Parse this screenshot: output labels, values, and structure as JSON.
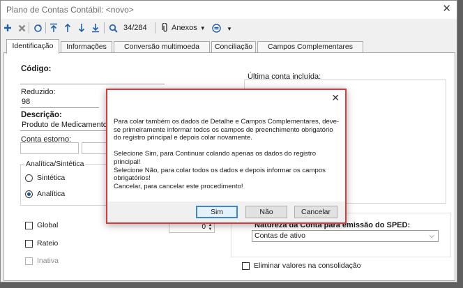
{
  "window": {
    "title": "Plano de Contas Contábil: <novo>",
    "close_glyph": "✕"
  },
  "toolbar": {
    "counter": "34/284",
    "anexos_label": "Anexos",
    "icons": [
      "plus-icon",
      "delete-icon",
      "refresh-icon",
      "first-record-icon",
      "previous-record-icon",
      "next-record-icon",
      "last-record-icon",
      "search-icon",
      "paperclip-icon",
      "options-icon"
    ]
  },
  "tabs": [
    "Identificação",
    "Informações",
    "Conversão multimoeda",
    "Conciliação",
    "Campos Complementares"
  ],
  "form": {
    "codigo_label": "Código:",
    "codigo_value": "",
    "reduzido_label": "Reduzido:",
    "reduzido_value": "98",
    "descricao_label": "Descrição:",
    "descricao_value": "Produto de Medicamento",
    "conta_estorno_label": "Conta estorno:",
    "ultima_conta_label": "Última conta incluída:",
    "analitica_sintetica_label": "Analítica/Sintética",
    "sintetica_label": "Sintética",
    "analitica_label": "Analítica",
    "global_label": "Global",
    "rateio_label": "Rateio",
    "inativa_label": "Inativa",
    "spin_value": "0",
    "sped_label": "Natureza da Conta para emissão do SPED:",
    "sped_value": "Contas de ativo",
    "eliminar_label": "Eliminar valores na consolidação"
  },
  "dialog": {
    "close_glyph": "✕",
    "paragraph1": "Para colar também os dados de Detalhe e Campos Complementares, deve-se primeiramente informar todos os campos de preenchimento obrigatório do registro principal e depois colar novamente.",
    "line_sim": "Selecione Sim, para Continuar colando apenas os dados do registro principal!",
    "line_nao": "Selecione Não, para colar todos os dados e depois informar os campos obrigatórios!",
    "line_cancelar": "Cancelar, para cancelar este procedimento!",
    "btn_sim": "Sim",
    "btn_nao": "Não",
    "btn_cancelar": "Cancelar"
  },
  "colors": {
    "accent": "#1f5fa8",
    "dialog_border": "#d63a3a",
    "default_button": "#3c86d6"
  }
}
